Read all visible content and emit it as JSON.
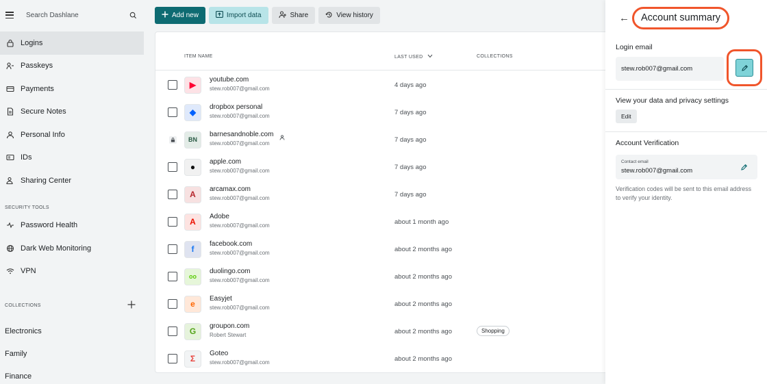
{
  "search": {
    "placeholder": "Search Dashlane",
    "icon": "search-icon"
  },
  "nav": [
    {
      "label": "Logins",
      "icon": "lock-icon",
      "active": true
    },
    {
      "label": "Passkeys",
      "icon": "passkey-icon"
    },
    {
      "label": "Payments",
      "icon": "card-icon"
    },
    {
      "label": "Secure Notes",
      "icon": "note-icon"
    },
    {
      "label": "Personal Info",
      "icon": "person-icon"
    },
    {
      "label": "IDs",
      "icon": "id-icon"
    },
    {
      "label": "Sharing Center",
      "icon": "sharing-icon"
    }
  ],
  "security_tools": {
    "label": "SECURITY TOOLS",
    "items": [
      {
        "label": "Password Health",
        "icon": "pulse-icon"
      },
      {
        "label": "Dark Web Monitoring",
        "icon": "globe-icon"
      },
      {
        "label": "VPN",
        "icon": "wifi-icon"
      }
    ]
  },
  "collections": {
    "label": "COLLECTIONS",
    "add_icon": "plus-icon",
    "items": [
      "Electronics",
      "Family",
      "Finance"
    ]
  },
  "toolbar": {
    "add_new": "Add new",
    "import_data": "Import data",
    "share": "Share",
    "view_history": "View history"
  },
  "list": {
    "headers": {
      "item_name": "ITEM NAME",
      "last_used": "LAST USED",
      "collections": "COLLECTIONS"
    },
    "rows": [
      {
        "name": "youtube.com",
        "sub": "stew.rob007@gmail.com",
        "last": "4 days ago",
        "logo": "youtube-logo",
        "color": "#ff0033",
        "bg": "#fde2e6"
      },
      {
        "name": "dropbox personal",
        "sub": "stew.rob007@gmail.com",
        "last": "7 days ago",
        "logo": "dropbox-logo",
        "color": "#0061fe",
        "bg": "#dfe9fb"
      },
      {
        "name": "barnesandnoble.com",
        "sub": "stew.rob007@gmail.com",
        "last": "7 days ago",
        "logo": "barnesandnoble-logo",
        "color": "#2a5a45",
        "bg": "#e3ece7",
        "locked": true,
        "shared": true
      },
      {
        "name": "apple.com",
        "sub": "stew.rob007@gmail.com",
        "last": "7 days ago",
        "logo": "apple-logo",
        "color": "#111111",
        "bg": "#f1f1f1"
      },
      {
        "name": "arcamax.com",
        "sub": "stew.rob007@gmail.com",
        "last": "7 days ago",
        "logo": "arcamax-logo",
        "color": "#b5272d",
        "bg": "#f7e1e1"
      },
      {
        "name": "Adobe",
        "sub": "stew.rob007@gmail.com",
        "last": "about 1 month ago",
        "logo": "adobe-logo",
        "color": "#eb1000",
        "bg": "#fde3e1"
      },
      {
        "name": "facebook.com",
        "sub": "stew.rob007@gmail.com",
        "last": "about 2 months ago",
        "logo": "facebook-logo",
        "color": "#1877f2",
        "bg": "#dfe3f0"
      },
      {
        "name": "duolingo.com",
        "sub": "stew.rob007@gmail.com",
        "last": "about 2 months ago",
        "logo": "duolingo-logo",
        "color": "#58cc02",
        "bg": "#e6f6d9"
      },
      {
        "name": "Easyjet",
        "sub": "stew.rob007@gmail.com",
        "last": "about 2 months ago",
        "logo": "easyjet-logo",
        "color": "#ff6600",
        "bg": "#ffe8d9"
      },
      {
        "name": "groupon.com",
        "sub": "Robert Stewart",
        "last": "about 2 months ago",
        "logo": "groupon-logo",
        "color": "#53a318",
        "bg": "#e6f3dc",
        "tag": "Shopping"
      },
      {
        "name": "Goteo",
        "sub": "stew.rob007@gmail.com",
        "last": "about 2 months ago",
        "logo": "goteo-logo",
        "color": "#e8413b",
        "bg": "#f2f4f5"
      }
    ]
  },
  "panel": {
    "title": "Account summary",
    "login_email_label": "Login email",
    "login_email": "stew.rob007@gmail.com",
    "privacy_label": "View your data and privacy settings",
    "privacy_button": "Edit",
    "verification_label": "Account Verification",
    "contact_label": "Contact email",
    "contact_email": "stew.rob007@gmail.com",
    "note": "Verification codes will be sent to this email address to verify your identity."
  }
}
